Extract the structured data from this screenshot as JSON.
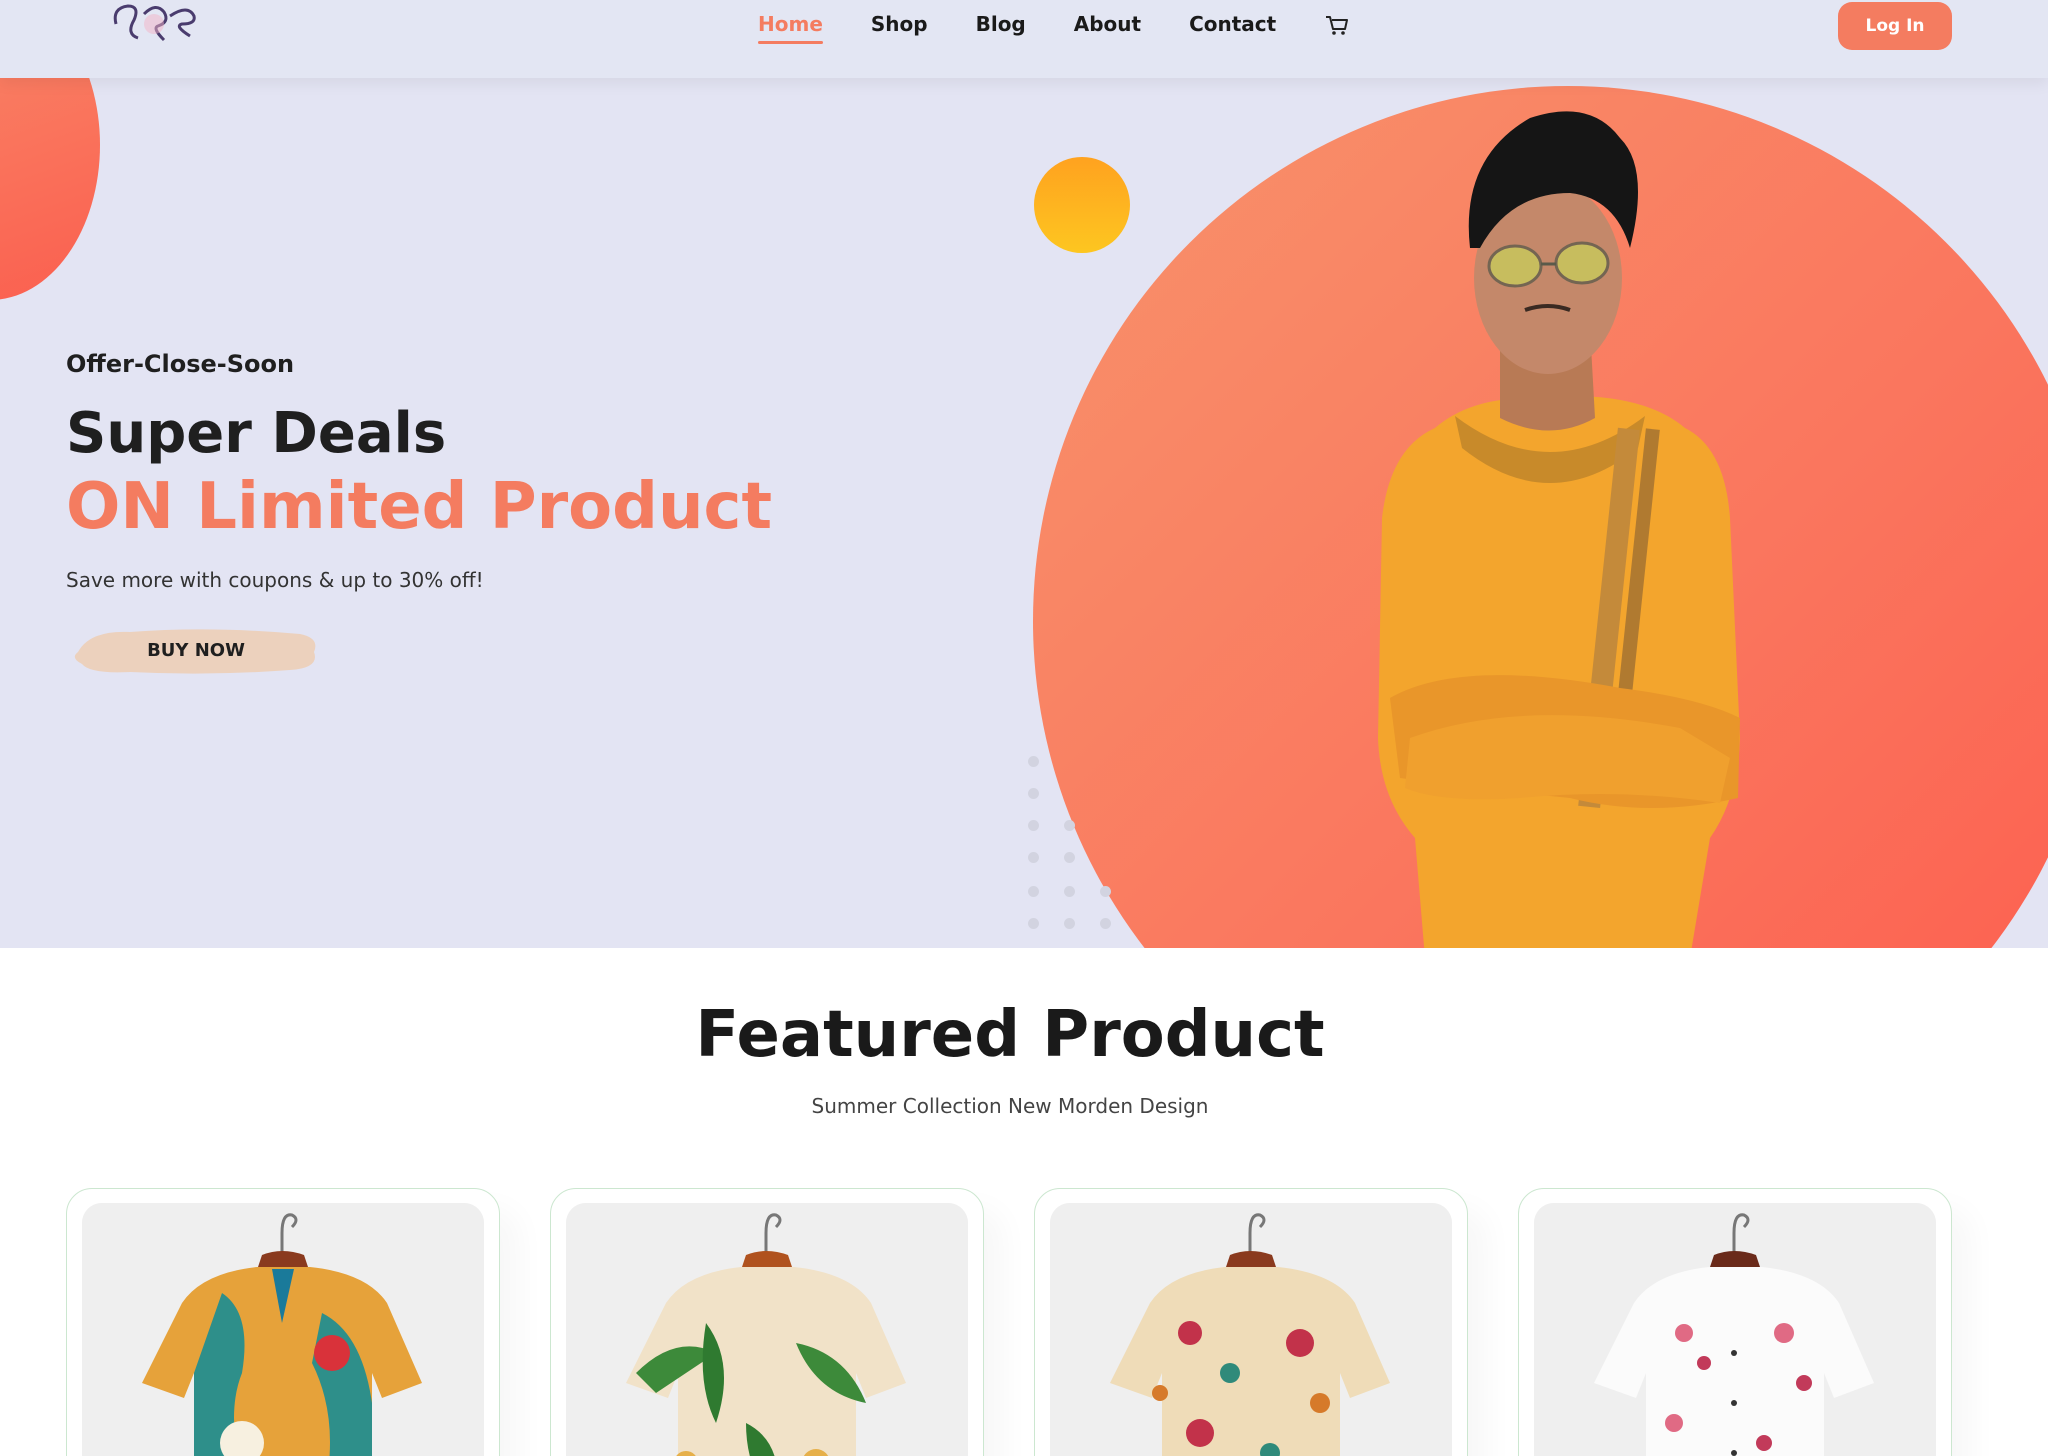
{
  "nav": {
    "links": [
      "Home",
      "Shop",
      "Blog",
      "About",
      "Contact"
    ],
    "active": "Home",
    "cart_icon": "cart-icon",
    "login_label": "Log In"
  },
  "hero": {
    "eyebrow": "Offer-Close-Soon",
    "title": "Super Deals",
    "title_accent": "ON Limited Product",
    "subtitle": "Save more with coupons & up to 30% off!",
    "cta_label": "BUY NOW"
  },
  "featured": {
    "title": "Featured Product",
    "subtitle": "Summer Collection New Morden Design",
    "products": [
      {
        "image": "tropical-print-shirt"
      },
      {
        "image": "leaf-print-shirt"
      },
      {
        "image": "floral-print-shirt"
      },
      {
        "image": "pink-blossom-shirt"
      }
    ]
  },
  "colors": {
    "accent": "#f47c60",
    "nav_bg": "#e3e6f3",
    "hero_bg": "#e3e4f3",
    "card_border": "#cce7d0"
  }
}
